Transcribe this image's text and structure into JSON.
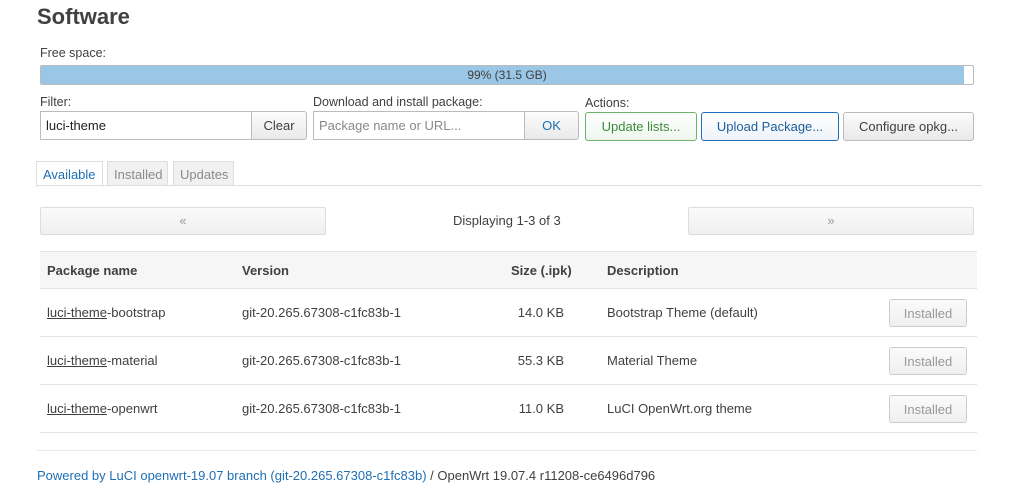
{
  "page": {
    "title": "Software"
  },
  "free_space": {
    "label": "Free space:",
    "text": "99% (31.5 GB)",
    "percent": 99
  },
  "filter": {
    "label": "Filter:",
    "value": "luci-theme",
    "clear_label": "Clear"
  },
  "download": {
    "label": "Download and install package:",
    "placeholder": "Package name or URL...",
    "ok_label": "OK"
  },
  "actions": {
    "label": "Actions:",
    "update_lists": "Update lists...",
    "upload_package": "Upload Package...",
    "configure_opkg": "Configure opkg..."
  },
  "tabs": [
    {
      "label": "Available",
      "active": true
    },
    {
      "label": "Installed",
      "active": false
    },
    {
      "label": "Updates",
      "active": false
    }
  ],
  "pager": {
    "prev": "«",
    "next": "»",
    "text": "Displaying 1-3 of 3"
  },
  "table": {
    "headers": [
      "Package name",
      "Version",
      "Size (.ipk)",
      "Description"
    ],
    "rows": [
      {
        "name_prefix": "luci-theme",
        "name_suffix": "-bootstrap",
        "version": "git-20.265.67308-c1fc83b-1",
        "size": "14.0 KB",
        "description": "Bootstrap Theme (default)",
        "action": "Installed"
      },
      {
        "name_prefix": "luci-theme",
        "name_suffix": "-material",
        "version": "git-20.265.67308-c1fc83b-1",
        "size": "55.3 KB",
        "description": "Material Theme",
        "action": "Installed"
      },
      {
        "name_prefix": "luci-theme",
        "name_suffix": "-openwrt",
        "version": "git-20.265.67308-c1fc83b-1",
        "size": "11.0 KB",
        "description": "LuCI OpenWrt.org theme",
        "action": "Installed"
      }
    ]
  },
  "footer": {
    "link_text": "Powered by LuCI openwrt-19.07 branch (git-20.265.67308-c1fc83b)",
    "text": " / OpenWrt 19.07.4 r11208-ce6496d796"
  }
}
